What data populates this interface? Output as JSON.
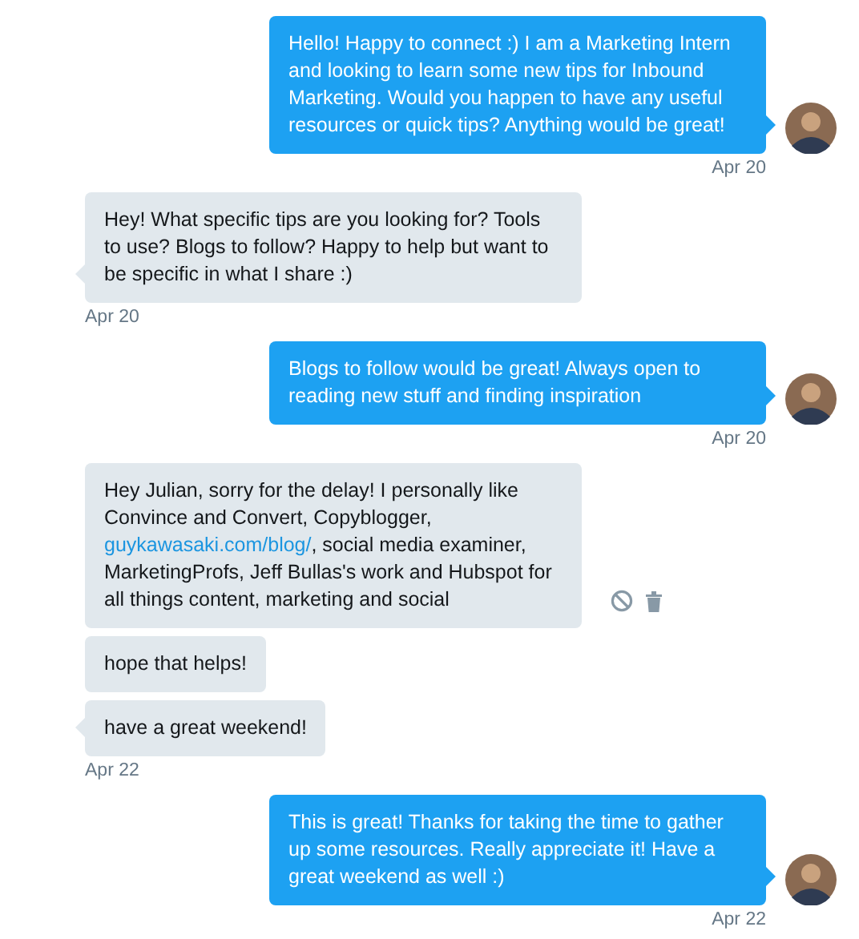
{
  "groups": [
    {
      "outgoing": true,
      "time": "Apr 20",
      "messages": [
        {
          "parts": [
            {
              "kind": "plain",
              "text": "Hello! Happy to connect :) I am a Marketing Intern and looking to learn some new tips for Inbound Marketing. Would you happen to have any useful resources or quick tips? Anything would be great!"
            }
          ]
        }
      ]
    },
    {
      "outgoing": false,
      "time": "Apr 20",
      "messages": [
        {
          "parts": [
            {
              "kind": "plain",
              "text": "Hey! What specific tips are you looking for? Tools to use? Blogs to follow? Happy to help but want to be specific in what I share :)"
            }
          ]
        }
      ]
    },
    {
      "outgoing": true,
      "time": "Apr 20",
      "messages": [
        {
          "parts": [
            {
              "kind": "plain",
              "text": "Blogs to follow would be great! Always open to reading new stuff and finding inspiration"
            }
          ]
        }
      ]
    },
    {
      "outgoing": false,
      "time": "Apr 22",
      "messages": [
        {
          "actions": true,
          "parts": [
            {
              "kind": "plain",
              "text": "Hey Julian, sorry for the delay! I personally like Convince and Convert, Copyblogger, "
            },
            {
              "kind": "link",
              "text": "guykawasaki.com/blog/"
            },
            {
              "kind": "plain",
              "text": ", social media examiner, MarketingProfs, Jeff Bullas's work and Hubspot for all things content, marketing and social"
            }
          ]
        },
        {
          "actions": false,
          "parts": [
            {
              "kind": "plain",
              "text": "hope that helps!"
            }
          ]
        },
        {
          "actions": false,
          "parts": [
            {
              "kind": "plain",
              "text": "have a great weekend!"
            }
          ]
        }
      ]
    },
    {
      "outgoing": true,
      "time": "Apr 22",
      "messages": [
        {
          "parts": [
            {
              "kind": "plain",
              "text": "This is great! Thanks for taking the time to gather up some resources. Really appreciate it! Have a great weekend as well :)"
            }
          ]
        }
      ]
    }
  ]
}
